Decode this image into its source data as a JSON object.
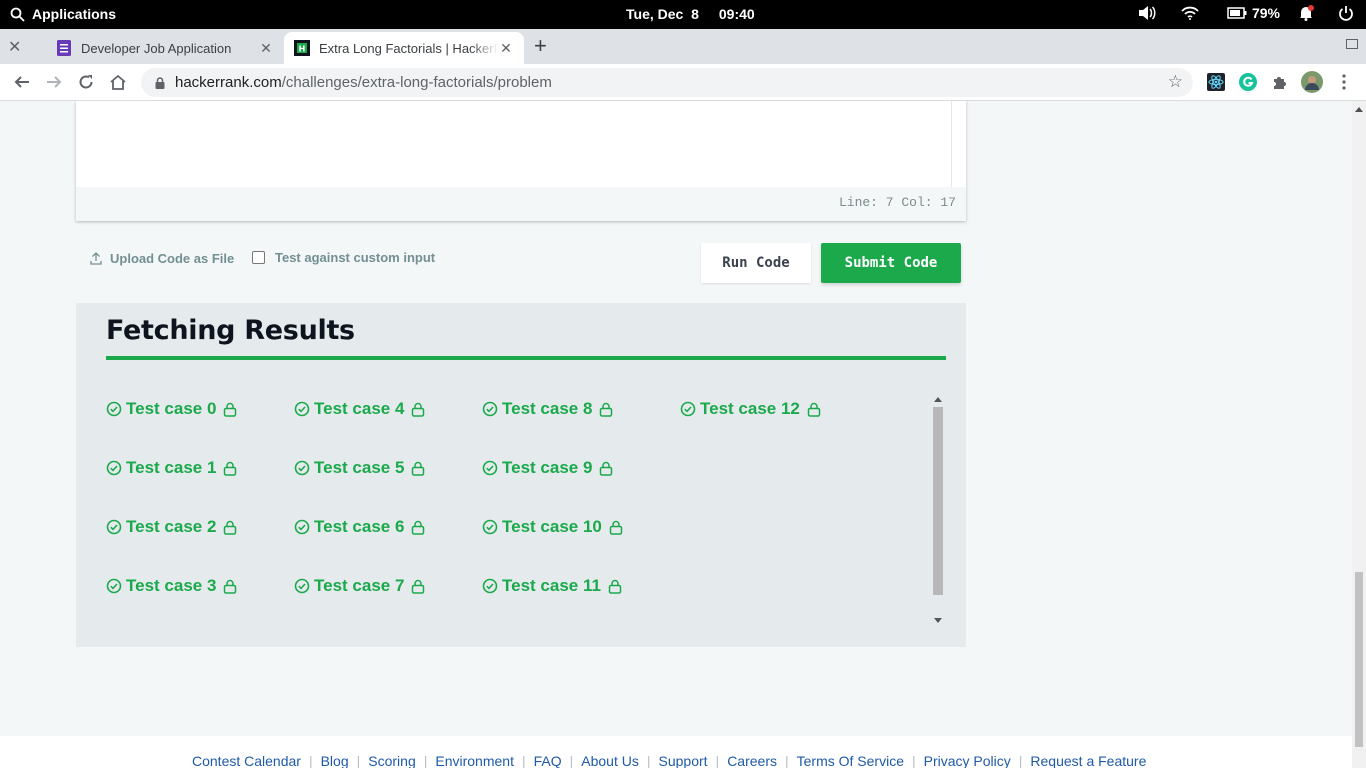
{
  "topbar": {
    "apps_label": "Applications",
    "date": "Tue, Dec  8",
    "time": "09:40",
    "battery": "79%"
  },
  "tabs": [
    {
      "title": "Developer Job Application",
      "favicon": "forms-icon",
      "active": false
    },
    {
      "title": "Extra Long Factorials | HackerRank",
      "favicon": "hackerrank-icon",
      "active": true
    }
  ],
  "address": {
    "host": "hackerrank.com",
    "path": "/challenges/extra-long-factorials/problem"
  },
  "editor": {
    "status": "Line: 7 Col: 17"
  },
  "actions": {
    "upload_label": "Upload Code as File",
    "custom_input_label": "Test against custom input",
    "run_label": "Run Code",
    "submit_label": "Submit Code"
  },
  "results": {
    "heading": "Fetching Results",
    "test_cases": [
      "Test case 0",
      "Test case 1",
      "Test case 2",
      "Test case 3",
      "Test case 4",
      "Test case 5",
      "Test case 6",
      "Test case 7",
      "Test case 8",
      "Test case 9",
      "Test case 10",
      "Test case 11",
      "Test case 12"
    ]
  },
  "footer": {
    "links": [
      "Contest Calendar",
      "Blog",
      "Scoring",
      "Environment",
      "FAQ",
      "About Us",
      "Support",
      "Careers",
      "Terms Of Service",
      "Privacy Policy",
      "Request a Feature"
    ]
  },
  "colors": {
    "accent": "#1ba94c",
    "heading": "#0e141e",
    "link": "#1f5aa8"
  }
}
